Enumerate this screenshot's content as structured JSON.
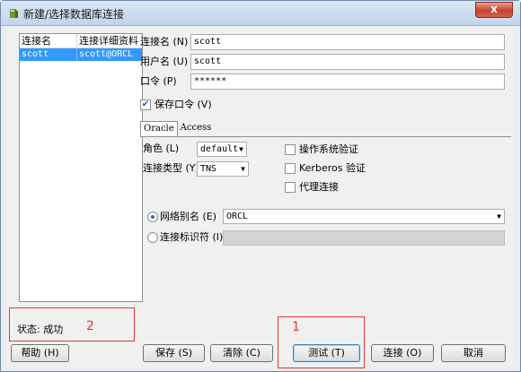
{
  "window": {
    "title": "新建/选择数据库连接",
    "close_label": "x"
  },
  "list": {
    "headers": [
      "连接名",
      "连接详细资料"
    ],
    "rows": [
      {
        "name": "scott",
        "detail": "scott@ORCL"
      }
    ]
  },
  "status": {
    "text": "状态: 成功"
  },
  "form": {
    "conn_name_label": "连接名 (N)",
    "conn_name_value": "scott",
    "user_label": "用户名 (U)",
    "user_value": "scott",
    "password_label": "口令 (P)",
    "password_value": "******",
    "save_password_label": "保存口令 (V)"
  },
  "tabs": [
    "Oracle",
    "Access"
  ],
  "oracle": {
    "role_label": "角色 (L)",
    "role_value": "default",
    "conn_type_label": "连接类型 (Y)",
    "conn_type_value": "TNS",
    "os_auth_label": "操作系统验证",
    "kerberos_label": "Kerberos 验证",
    "proxy_label": "代理连接",
    "net_alias_label": "网络别名 (E)",
    "net_alias_value": "ORCL",
    "conn_id_label": "连接标识符 (I)"
  },
  "buttons": {
    "help": "帮助 (H)",
    "save": "保存 (S)",
    "clear": "清除 (C)",
    "test": "测试 (T)",
    "connect": "连接 (O)",
    "cancel": "取消"
  },
  "annotations": [
    "1",
    "2"
  ],
  "colors": {
    "selection": "#3399ff",
    "annotation": "#e8362c"
  }
}
